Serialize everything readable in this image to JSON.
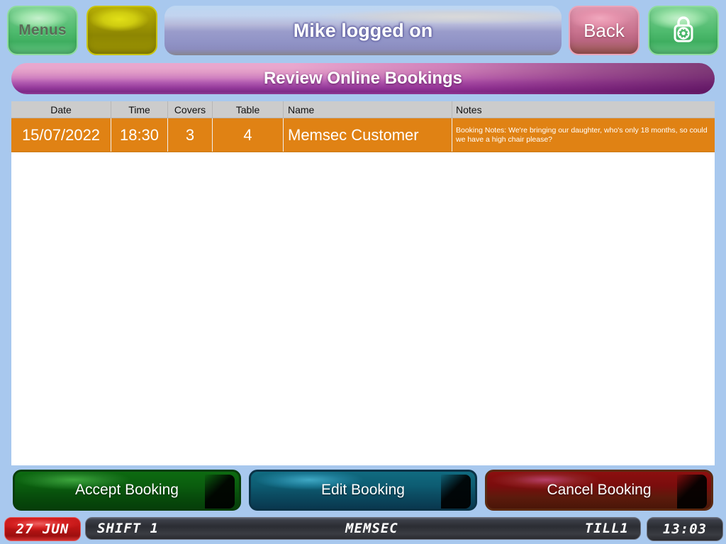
{
  "theme": {
    "background": "#a8c8ee",
    "row_highlight": "#e08214",
    "header_bg": "#cccccc",
    "title_accent": "#93399a"
  },
  "topbar": {
    "menus_button": "Menus",
    "blank_button": "",
    "status_banner": "Mike logged on",
    "back_button": "Back",
    "lock_icon": "padlock-icon"
  },
  "page": {
    "title": "Review Online Bookings"
  },
  "table": {
    "columns": [
      "Date",
      "Time",
      "Covers",
      "Table",
      "Name",
      "Notes"
    ],
    "rows": [
      {
        "date": "15/07/2022",
        "time": "18:30",
        "covers": "3",
        "table": "4",
        "name": "Memsec Customer",
        "notes": "Booking Notes: We're bringing our daughter, who's only 18 months, so could we have a high chair please?",
        "selected": true
      }
    ]
  },
  "actions": {
    "accept": "Accept Booking",
    "edit": "Edit Booking",
    "cancel": "Cancel Booking"
  },
  "statusbar": {
    "date": "27 JUN",
    "shift": "SHIFT 1",
    "venue": "MEMSEC",
    "till": "TILL1",
    "time": "13:03"
  }
}
